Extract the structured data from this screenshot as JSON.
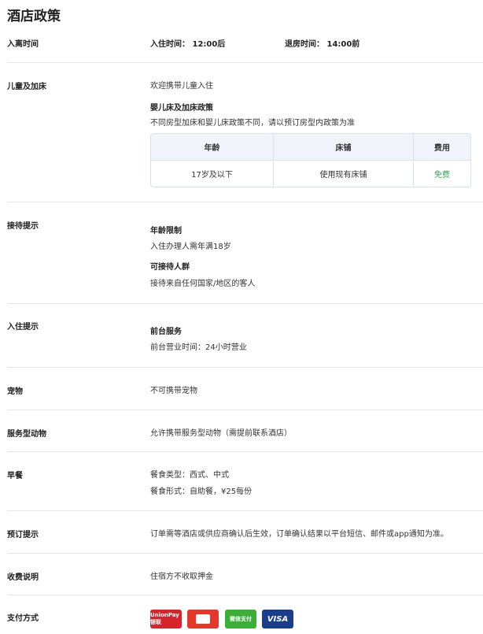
{
  "title": "酒店政策",
  "checkin": {
    "label": "入离时间",
    "in": "入住时间： 12:00后",
    "out": "退房时间： 14:00前"
  },
  "children": {
    "label": "儿童及加床",
    "welcome": "欢迎携带儿童入住",
    "subtitle": "婴儿床及加床政策",
    "desc": "不同房型加床和婴儿床政策不同，请以预订房型内政策为准",
    "headers": [
      "年龄",
      "床铺",
      "费用"
    ],
    "row": [
      "17岁及以下",
      "使用现有床铺",
      "免费"
    ],
    "free_color": "#2aa84a"
  },
  "reception": {
    "label": "接待提示",
    "age_title": "年龄限制",
    "age_text": "入住办理人需年满18岁",
    "guests_title": "可接待人群",
    "guests_text": "接待来自任何国家/地区的客人"
  },
  "checkin_tips": {
    "label": "入住提示",
    "title": "前台服务",
    "text": "前台营业时间：24小时营业"
  },
  "pets": {
    "label": "宠物",
    "text": "不可携带宠物"
  },
  "service_animals": {
    "label": "服务型动物",
    "text": "允许携带服务型动物（需提前联系酒店）"
  },
  "breakfast": {
    "label": "早餐",
    "type": "餐食类型：西式、中式",
    "form": "餐食形式：自助餐，¥25每份"
  },
  "booking": {
    "label": "预订提示",
    "text": "订单需等酒店或供应商确认后生效，订单确认结果以平台短信、邮件或app通知为准。"
  },
  "fees": {
    "label": "收费说明",
    "text": "住宿方不收取押金"
  },
  "payment": {
    "label": "支付方式",
    "methods": [
      {
        "icon": "unionpay-icon",
        "text": "UnionPay 银联",
        "color": "#d6242a"
      },
      {
        "icon": "card-icon",
        "text": "",
        "color": "#e5382b"
      },
      {
        "icon": "wechat-pay-icon",
        "text": "微信支付",
        "color": "#3ab036"
      },
      {
        "icon": "visa-icon",
        "text": "VISA",
        "color": "#1a3e8c"
      }
    ]
  }
}
